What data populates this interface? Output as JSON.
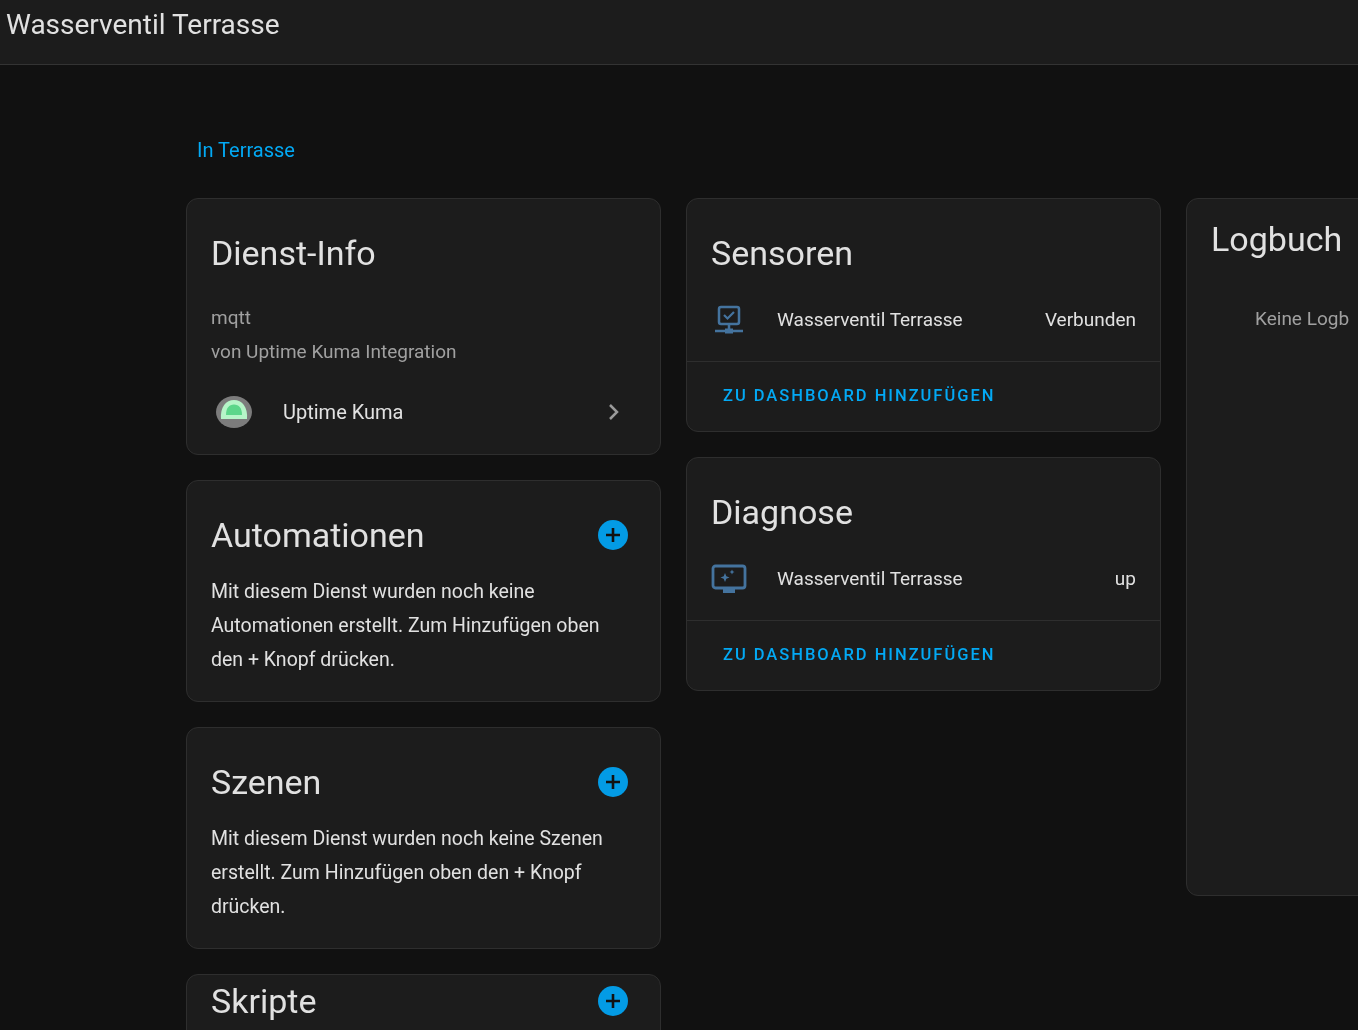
{
  "header": {
    "title": "Wasserventil Terrasse"
  },
  "breadcrumb": {
    "link": "In Terrasse"
  },
  "service_info": {
    "title": "Dienst-Info",
    "lines": [
      "mqtt",
      "von Uptime Kuma Integration"
    ],
    "integration": {
      "name": "Uptime Kuma"
    }
  },
  "automations": {
    "title": "Automationen",
    "text": "Mit diesem Dienst wurden noch keine Automationen erstellt. Zum Hinzufügen oben den + Knopf drücken."
  },
  "scenes": {
    "title": "Szenen",
    "text": "Mit diesem Dienst wurden noch keine Szenen erstellt. Zum Hinzufügen oben den + Knopf drücken."
  },
  "scripts": {
    "title": "Skripte"
  },
  "sensors": {
    "title": "Sensoren",
    "entities": [
      {
        "kind": "connectivity",
        "name": "Wasserventil Terrasse",
        "state": "Verbunden"
      }
    ],
    "action": "ZU DASHBOARD HINZUFÜGEN"
  },
  "diagnostics": {
    "title": "Diagnose",
    "entities": [
      {
        "kind": "monitor",
        "name": "Wasserventil Terrasse",
        "state": "up"
      }
    ],
    "action": "ZU DASHBOARD HINZUFÜGEN"
  },
  "logbook": {
    "title": "Logbuch",
    "empty": "Keine Logb"
  }
}
